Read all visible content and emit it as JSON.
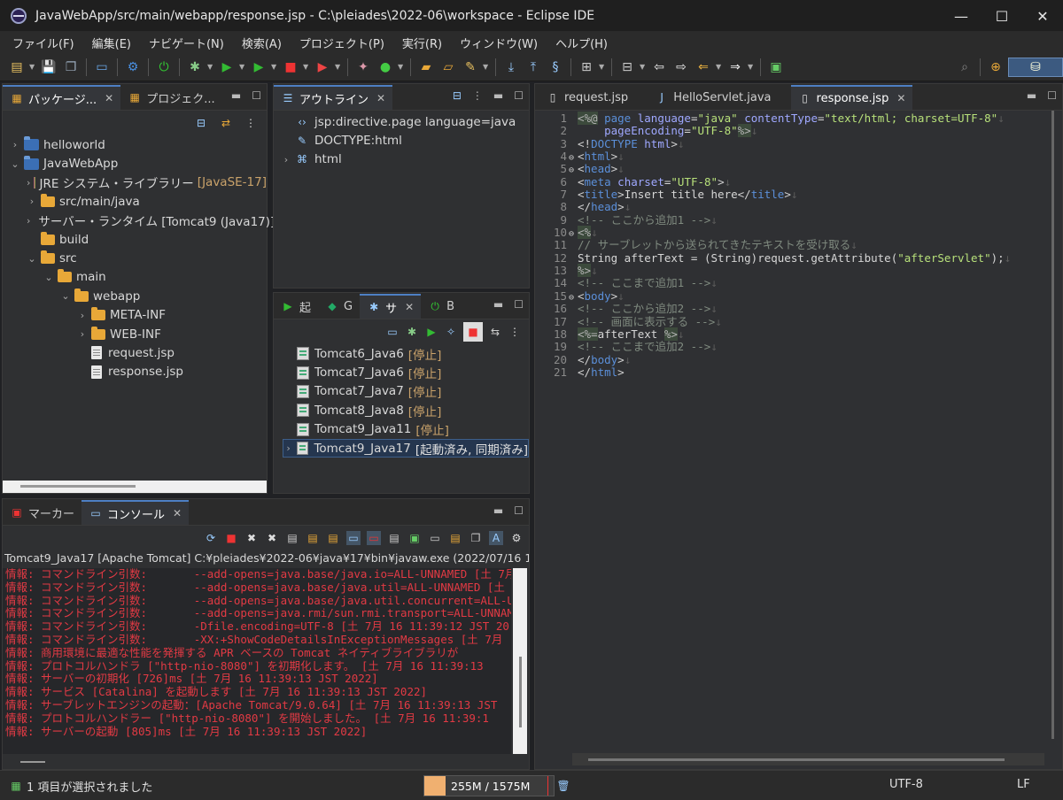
{
  "window": {
    "title": "JavaWebApp/src/main/webapp/response.jsp - C:\\pleiades\\2022-06\\workspace - Eclipse IDE",
    "minimize": "—",
    "maximize": "☐",
    "close": "✕"
  },
  "menu": [
    "ファイル(F)",
    "編集(E)",
    "ナビゲート(N)",
    "検索(A)",
    "プロジェクト(P)",
    "実行(R)",
    "ウィンドウ(W)",
    "ヘルプ(H)"
  ],
  "explorer": {
    "tabs": [
      "パッケージ...",
      "プロジェク..."
    ],
    "tree": [
      {
        "label": "helloworld",
        "extra": "",
        "depth": 0,
        "chev": "›",
        "icon": "project"
      },
      {
        "label": "JavaWebApp",
        "extra": "",
        "depth": 0,
        "chev": "⌄",
        "icon": "project"
      },
      {
        "label": "JRE システム・ライブラリー",
        "extra": "[JavaSE-17]",
        "depth": 1,
        "chev": "›",
        "icon": "library"
      },
      {
        "label": "src/main/java",
        "extra": "",
        "depth": 1,
        "chev": "›",
        "icon": "folder"
      },
      {
        "label": "サーバー・ランタイム [Tomcat9 (Java17)]",
        "extra": "",
        "depth": 1,
        "chev": "›",
        "icon": "library"
      },
      {
        "label": "build",
        "extra": "",
        "depth": 1,
        "chev": "",
        "icon": "folder"
      },
      {
        "label": "src",
        "extra": "",
        "depth": 1,
        "chev": "⌄",
        "icon": "folder"
      },
      {
        "label": "main",
        "extra": "",
        "depth": 2,
        "chev": "⌄",
        "icon": "folder"
      },
      {
        "label": "webapp",
        "extra": "",
        "depth": 3,
        "chev": "⌄",
        "icon": "folder"
      },
      {
        "label": "META-INF",
        "extra": "",
        "depth": 4,
        "chev": "›",
        "icon": "folder"
      },
      {
        "label": "WEB-INF",
        "extra": "",
        "depth": 4,
        "chev": "›",
        "icon": "folder"
      },
      {
        "label": "request.jsp",
        "extra": "",
        "depth": 4,
        "chev": "",
        "icon": "file"
      },
      {
        "label": "response.jsp",
        "extra": "",
        "depth": 4,
        "chev": "",
        "icon": "file"
      }
    ]
  },
  "outline": {
    "tab": "アウトライン",
    "items": [
      {
        "label": "jsp:directive.page language=java",
        "chev": "",
        "icon": "‹›"
      },
      {
        "label": "DOCTYPE:html",
        "chev": "",
        "icon": "✎"
      },
      {
        "label": "html",
        "chev": "›",
        "icon": "⌘"
      }
    ]
  },
  "servers": {
    "tabs": [
      "起",
      "G",
      "サ",
      "B"
    ],
    "items": [
      {
        "name": "Tomcat6_Java6",
        "state": "[停止]"
      },
      {
        "name": "Tomcat7_Java6",
        "state": "[停止]"
      },
      {
        "name": "Tomcat7_Java7",
        "state": "[停止]"
      },
      {
        "name": "Tomcat8_Java8",
        "state": "[停止]"
      },
      {
        "name": "Tomcat9_Java11",
        "state": "[停止]"
      },
      {
        "name": "Tomcat9_Java17",
        "state": "[起動済み, 同期済み]"
      }
    ]
  },
  "editor": {
    "tabs": [
      "request.jsp",
      "HelloServlet.java",
      "response.jsp"
    ],
    "active_tab": "response.jsp"
  },
  "console": {
    "tabs": [
      "マーカー",
      "コンソール"
    ],
    "header": "Tomcat9_Java17 [Apache Tomcat] C:¥pleiades¥2022-06¥java¥17¥bin¥javaw.exe  (2022/07/16 11:3",
    "lines": [
      "情報: コマンドライン引数:       --add-opens=java.base/java.io=ALL-UNNAMED [土 7月",
      "情報: コマンドライン引数:       --add-opens=java.base/java.util=ALL-UNNAMED [土 7",
      "情報: コマンドライン引数:       --add-opens=java.base/java.util.concurrent=ALL-U",
      "情報: コマンドライン引数:       --add-opens=java.rmi/sun.rmi.transport=ALL-UNNAM",
      "情報: コマンドライン引数:       -Dfile.encoding=UTF-8 [土 7月 16 11:39:12 JST 20",
      "情報: コマンドライン引数:       -XX:+ShowCodeDetailsInExceptionMessages [土 7月",
      "情報: 商用環境に最適な性能を発揮する APR ベースの Tomcat ネイティブライブラリが",
      "情報: プロトコルハンドラ [\"http-nio-8080\"] を初期化します。 [土 7月 16 11:39:13",
      "情報: サーバーの初期化 [726]ms [土 7月 16 11:39:13 JST 2022]",
      "情報: サービス [Catalina] を起動します [土 7月 16 11:39:13 JST 2022]",
      "情報: サーブレットエンジンの起動：[Apache Tomcat/9.0.64] [土 7月 16 11:39:13 JST",
      "情報: プロトコルハンドラー [\"http-nio-8080\"] を開始しました。 [土 7月 16 11:39:1",
      "情報: サーバーの起動 [805]ms [土 7月 16 11:39:13 JST 2022]"
    ]
  },
  "status": {
    "selection": "1 項目が選択されました",
    "memory": "255M / 1575M",
    "memory_used_fraction": 0.162,
    "encoding": "UTF-8",
    "line_ending": "LF"
  }
}
